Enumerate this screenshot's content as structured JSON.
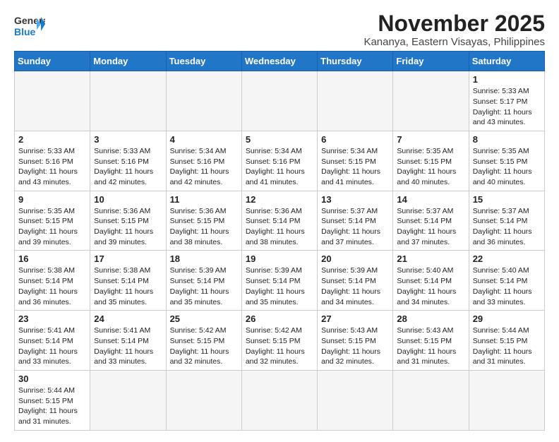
{
  "header": {
    "logo_line1": "General",
    "logo_line2": "Blue",
    "month_title": "November 2025",
    "location": "Kananya, Eastern Visayas, Philippines"
  },
  "weekdays": [
    "Sunday",
    "Monday",
    "Tuesday",
    "Wednesday",
    "Thursday",
    "Friday",
    "Saturday"
  ],
  "weeks": [
    [
      {
        "day": null
      },
      {
        "day": null
      },
      {
        "day": null
      },
      {
        "day": null
      },
      {
        "day": null
      },
      {
        "day": null
      },
      {
        "day": 1,
        "sunrise": "5:33 AM",
        "sunset": "5:17 PM",
        "daylight": "11 hours and 43 minutes."
      }
    ],
    [
      {
        "day": 2,
        "sunrise": "5:33 AM",
        "sunset": "5:16 PM",
        "daylight": "11 hours and 43 minutes."
      },
      {
        "day": 3,
        "sunrise": "5:33 AM",
        "sunset": "5:16 PM",
        "daylight": "11 hours and 42 minutes."
      },
      {
        "day": 4,
        "sunrise": "5:34 AM",
        "sunset": "5:16 PM",
        "daylight": "11 hours and 42 minutes."
      },
      {
        "day": 5,
        "sunrise": "5:34 AM",
        "sunset": "5:16 PM",
        "daylight": "11 hours and 41 minutes."
      },
      {
        "day": 6,
        "sunrise": "5:34 AM",
        "sunset": "5:15 PM",
        "daylight": "11 hours and 41 minutes."
      },
      {
        "day": 7,
        "sunrise": "5:35 AM",
        "sunset": "5:15 PM",
        "daylight": "11 hours and 40 minutes."
      },
      {
        "day": 8,
        "sunrise": "5:35 AM",
        "sunset": "5:15 PM",
        "daylight": "11 hours and 40 minutes."
      }
    ],
    [
      {
        "day": 9,
        "sunrise": "5:35 AM",
        "sunset": "5:15 PM",
        "daylight": "11 hours and 39 minutes."
      },
      {
        "day": 10,
        "sunrise": "5:36 AM",
        "sunset": "5:15 PM",
        "daylight": "11 hours and 39 minutes."
      },
      {
        "day": 11,
        "sunrise": "5:36 AM",
        "sunset": "5:15 PM",
        "daylight": "11 hours and 38 minutes."
      },
      {
        "day": 12,
        "sunrise": "5:36 AM",
        "sunset": "5:14 PM",
        "daylight": "11 hours and 38 minutes."
      },
      {
        "day": 13,
        "sunrise": "5:37 AM",
        "sunset": "5:14 PM",
        "daylight": "11 hours and 37 minutes."
      },
      {
        "day": 14,
        "sunrise": "5:37 AM",
        "sunset": "5:14 PM",
        "daylight": "11 hours and 37 minutes."
      },
      {
        "day": 15,
        "sunrise": "5:37 AM",
        "sunset": "5:14 PM",
        "daylight": "11 hours and 36 minutes."
      }
    ],
    [
      {
        "day": 16,
        "sunrise": "5:38 AM",
        "sunset": "5:14 PM",
        "daylight": "11 hours and 36 minutes."
      },
      {
        "day": 17,
        "sunrise": "5:38 AM",
        "sunset": "5:14 PM",
        "daylight": "11 hours and 35 minutes."
      },
      {
        "day": 18,
        "sunrise": "5:39 AM",
        "sunset": "5:14 PM",
        "daylight": "11 hours and 35 minutes."
      },
      {
        "day": 19,
        "sunrise": "5:39 AM",
        "sunset": "5:14 PM",
        "daylight": "11 hours and 35 minutes."
      },
      {
        "day": 20,
        "sunrise": "5:39 AM",
        "sunset": "5:14 PM",
        "daylight": "11 hours and 34 minutes."
      },
      {
        "day": 21,
        "sunrise": "5:40 AM",
        "sunset": "5:14 PM",
        "daylight": "11 hours and 34 minutes."
      },
      {
        "day": 22,
        "sunrise": "5:40 AM",
        "sunset": "5:14 PM",
        "daylight": "11 hours and 33 minutes."
      }
    ],
    [
      {
        "day": 23,
        "sunrise": "5:41 AM",
        "sunset": "5:14 PM",
        "daylight": "11 hours and 33 minutes."
      },
      {
        "day": 24,
        "sunrise": "5:41 AM",
        "sunset": "5:14 PM",
        "daylight": "11 hours and 33 minutes."
      },
      {
        "day": 25,
        "sunrise": "5:42 AM",
        "sunset": "5:15 PM",
        "daylight": "11 hours and 32 minutes."
      },
      {
        "day": 26,
        "sunrise": "5:42 AM",
        "sunset": "5:15 PM",
        "daylight": "11 hours and 32 minutes."
      },
      {
        "day": 27,
        "sunrise": "5:43 AM",
        "sunset": "5:15 PM",
        "daylight": "11 hours and 32 minutes."
      },
      {
        "day": 28,
        "sunrise": "5:43 AM",
        "sunset": "5:15 PM",
        "daylight": "11 hours and 31 minutes."
      },
      {
        "day": 29,
        "sunrise": "5:44 AM",
        "sunset": "5:15 PM",
        "daylight": "11 hours and 31 minutes."
      }
    ],
    [
      {
        "day": 30,
        "sunrise": "5:44 AM",
        "sunset": "5:15 PM",
        "daylight": "11 hours and 31 minutes."
      },
      {
        "day": null
      },
      {
        "day": null
      },
      {
        "day": null
      },
      {
        "day": null
      },
      {
        "day": null
      },
      {
        "day": null
      }
    ]
  ]
}
